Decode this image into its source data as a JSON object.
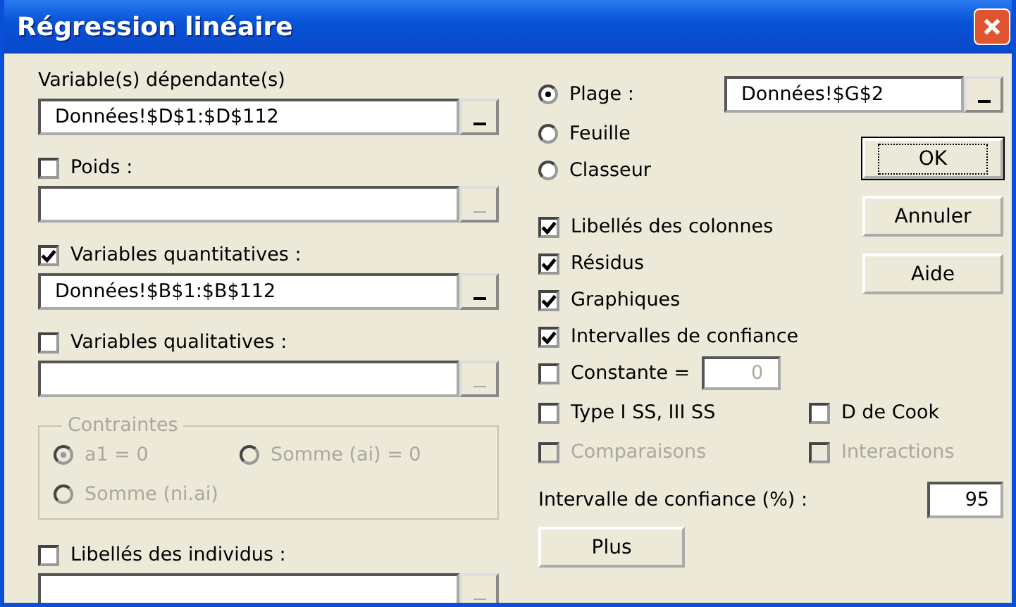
{
  "window": {
    "title": "Régression linéaire"
  },
  "left": [
    {
      "kind": "plain",
      "label": "Variable(s) dépendante(s)",
      "value": "Données!$D$1:$D$112",
      "disabled": false
    },
    {
      "kind": "check",
      "label": "Poids :",
      "checked": false,
      "disabled": true
    },
    {
      "kind": "check",
      "label": "Variables quantitatives :",
      "checked": true,
      "value": "Données!$B$1:$B$112",
      "disabled": false
    },
    {
      "kind": "check",
      "label": "Variables qualitatives :",
      "checked": false,
      "disabled": true
    },
    {
      "kind": "group",
      "title": "Contraintes",
      "disabled": true,
      "options": [
        {
          "label": "a1 = 0",
          "selected": true
        },
        {
          "label": "Somme (ai) = 0",
          "selected": false
        },
        {
          "label": "Somme (ni.ai)",
          "selected": false
        }
      ]
    },
    {
      "kind": "check",
      "label": "Libellés des individus :",
      "checked": false,
      "disabled": true
    }
  ],
  "output": {
    "options": [
      {
        "label": "Plage :",
        "selected": true
      },
      {
        "label": "Feuille",
        "selected": false
      },
      {
        "label": "Classeur",
        "selected": false
      }
    ],
    "value": "Données!$G$2"
  },
  "buttons": [
    {
      "label": "OK",
      "default": true
    },
    {
      "label": "Annuler",
      "default": false
    },
    {
      "label": "Aide",
      "default": false
    }
  ],
  "checks": [
    {
      "kind": "plain",
      "label": "Libellés des colonnes",
      "checked": true
    },
    {
      "kind": "plain",
      "label": "Résidus",
      "checked": true
    },
    {
      "kind": "plain",
      "label": "Graphiques",
      "checked": true
    },
    {
      "kind": "plain",
      "label": "Intervalles de confiance",
      "checked": true
    },
    {
      "kind": "input",
      "label": "Constante =",
      "checked": false,
      "value": "0"
    }
  ],
  "pairs": [
    [
      {
        "label": "Type I SS, III SS",
        "checked": false,
        "disabled": false
      },
      {
        "label": "D de Cook",
        "checked": false,
        "disabled": false
      }
    ],
    [
      {
        "label": "Comparaisons",
        "checked": false,
        "disabled": true
      },
      {
        "label": "Interactions",
        "checked": false,
        "disabled": true
      }
    ]
  ],
  "confidence": {
    "label": "Intervalle de confiance (%) :",
    "value": "95"
  },
  "more_button": "Plus"
}
